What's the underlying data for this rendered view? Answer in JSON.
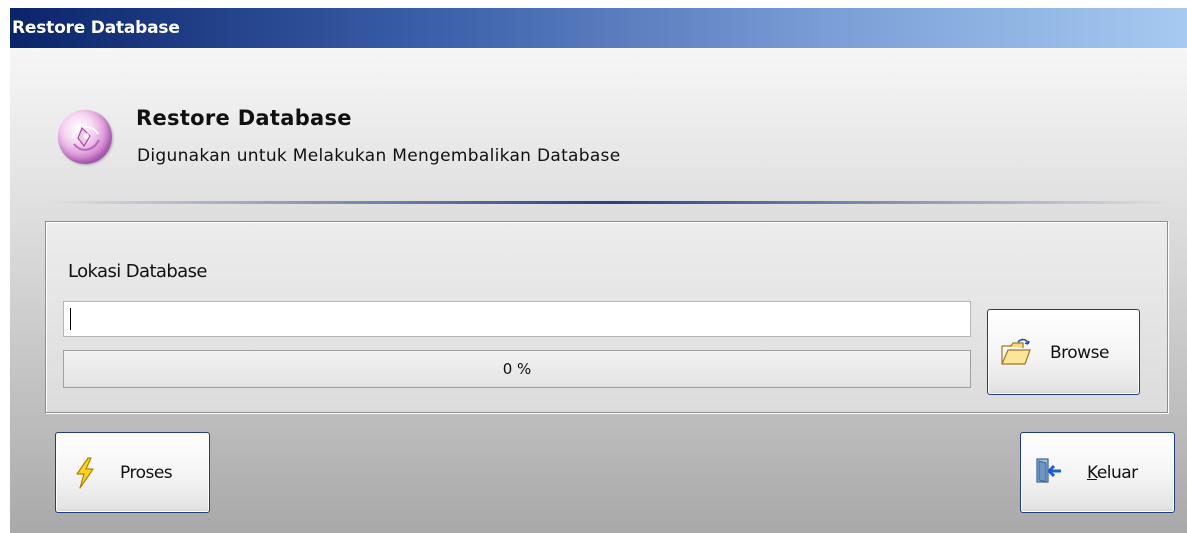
{
  "window": {
    "title": "Restore Database"
  },
  "header": {
    "icon": "database-orb-icon",
    "title": "Restore Database",
    "subtitle": "Digunakan untuk Melakukan Mengembalikan Database"
  },
  "form": {
    "location_label": "Lokasi Database",
    "location_value": "",
    "location_placeholder": "",
    "progress": {
      "percent": 0,
      "text": "0 %"
    }
  },
  "buttons": {
    "browse": {
      "label": "Browse",
      "icon": "open-folder-icon"
    },
    "proses": {
      "label": "Proses",
      "icon": "lightning-icon"
    },
    "keluar": {
      "label_accel": "K",
      "label_rest": "eluar",
      "icon": "exit-door-icon"
    }
  },
  "colors": {
    "titlebar_start": "#0a246a",
    "titlebar_end": "#a6caf0",
    "button_border": "#1f3f7a"
  }
}
